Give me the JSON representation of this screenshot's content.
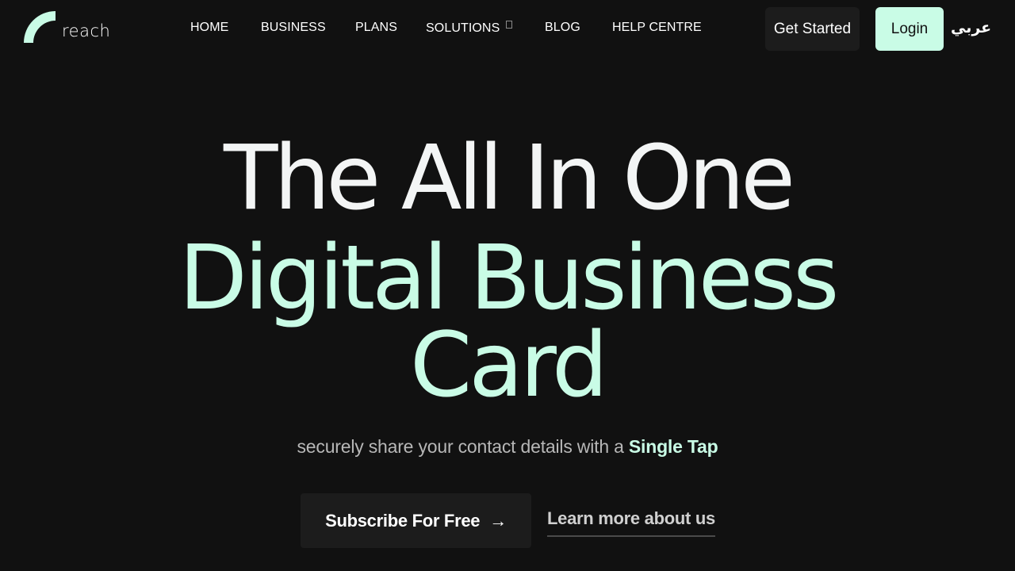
{
  "brand": {
    "name": "reach",
    "accent_color": "#c9fce6",
    "background_color": "#111111"
  },
  "nav": {
    "items": [
      {
        "label": "HOME"
      },
      {
        "label": "BUSINESS"
      },
      {
        "label": "PLANS"
      },
      {
        "label": "SOLUTIONS",
        "has_dropdown": true
      },
      {
        "label": "BLOG"
      },
      {
        "label": "HELP CENTRE"
      }
    ]
  },
  "header_actions": {
    "get_started_label": "Get Started",
    "login_label": "Login",
    "language_label": "عربي"
  },
  "hero": {
    "line1": "The All In One",
    "line2a": "Digital Business",
    "line2b": "Card",
    "subtitle_prefix": "securely share your contact details with a ",
    "subtitle_accent": "Single Tap"
  },
  "cta": {
    "subscribe_label": "Subscribe For Free",
    "subscribe_icon": "arrow-right-icon",
    "learn_more_label": "Learn more about us"
  }
}
